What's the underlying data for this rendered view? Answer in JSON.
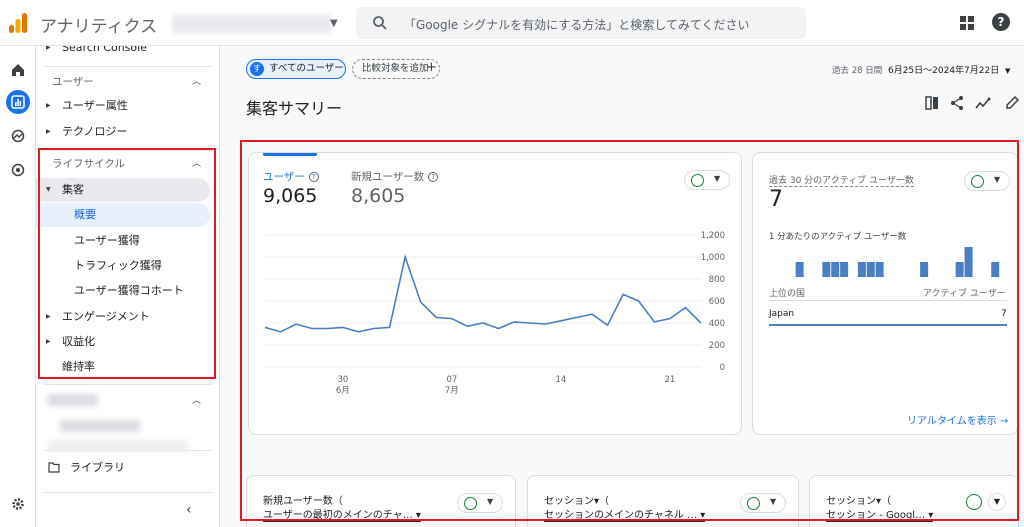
{
  "header": {
    "app_title": "アナリティクス",
    "search_placeholder": "「Google シグナルを有効にする方法」と検索してみてください"
  },
  "sidebar": {
    "search_console": "Search Console",
    "user_section": "ユーザー",
    "user_attributes": "ユーザー属性",
    "technology": "テクノロジー",
    "lifecycle_section": "ライフサイクル",
    "acquisition": "集客",
    "overview": "概要",
    "user_acquisition": "ユーザー獲得",
    "traffic_acquisition": "トラフィック獲得",
    "user_acquisition_cohort": "ユーザー獲得コホート",
    "engagement": "エンゲージメント",
    "monetization": "収益化",
    "retention": "維持率",
    "library": "ライブラリ"
  },
  "filters": {
    "all_users_badge": "す",
    "all_users": "すべてのユーザー",
    "add_comparison": "比較対象を追加"
  },
  "date_range": {
    "prefix": "過去 28 日間",
    "range": "6月25日～2024年7月22日"
  },
  "page": {
    "title": "集客サマリー"
  },
  "overview_card": {
    "metric1_label": "ユーザー",
    "metric1_value": "9,065",
    "metric2_label": "新規ユーザー数",
    "metric2_value": "8,605"
  },
  "chart_data": {
    "type": "line",
    "series": [
      {
        "values": [
          360,
          320,
          390,
          350,
          350,
          360,
          320,
          350,
          360,
          1000,
          590,
          450,
          440,
          370,
          400,
          350,
          410,
          400,
          390,
          420,
          450,
          480,
          380,
          660,
          600,
          410,
          440,
          540,
          400
        ]
      }
    ],
    "y_ticks": [
      "1,200",
      "1,000",
      "800",
      "600",
      "400",
      "200",
      "0"
    ],
    "x_ticks": [
      {
        "day": "30",
        "month": "6月"
      },
      {
        "day": "07",
        "month": "7月"
      },
      {
        "day": "14",
        "month": ""
      },
      {
        "day": "21",
        "month": ""
      }
    ],
    "ylim": [
      0,
      1200
    ],
    "color": "#4a7fc1"
  },
  "realtime_card": {
    "title": "過去 30 分のアクティブ ユーザー数",
    "value": "7",
    "per_minute_label": "1 分あたりのアクティブ ユーザー数",
    "bars": [
      0,
      0,
      0,
      1,
      0,
      0,
      1,
      1,
      1,
      0,
      1,
      1,
      1,
      0,
      0,
      0,
      0,
      1,
      0,
      0,
      0,
      1,
      2,
      0,
      0,
      1,
      0
    ],
    "col_country": "上位の国",
    "col_users": "アクティブ ユーザー",
    "row_country": "Japan",
    "row_value": "7",
    "view_realtime": "リアルタイムを表示"
  },
  "bottom_cards": [
    {
      "title_line1": "新規ユーザー数（",
      "title_line2": "ユーザーの最初のメインのチャ…"
    },
    {
      "title_line1": "セッション▾（",
      "title_line2": "セッションのメインのチャネル …"
    },
    {
      "title_line1": "セッション▾（",
      "title_line2": "セッション - Googl…"
    }
  ]
}
